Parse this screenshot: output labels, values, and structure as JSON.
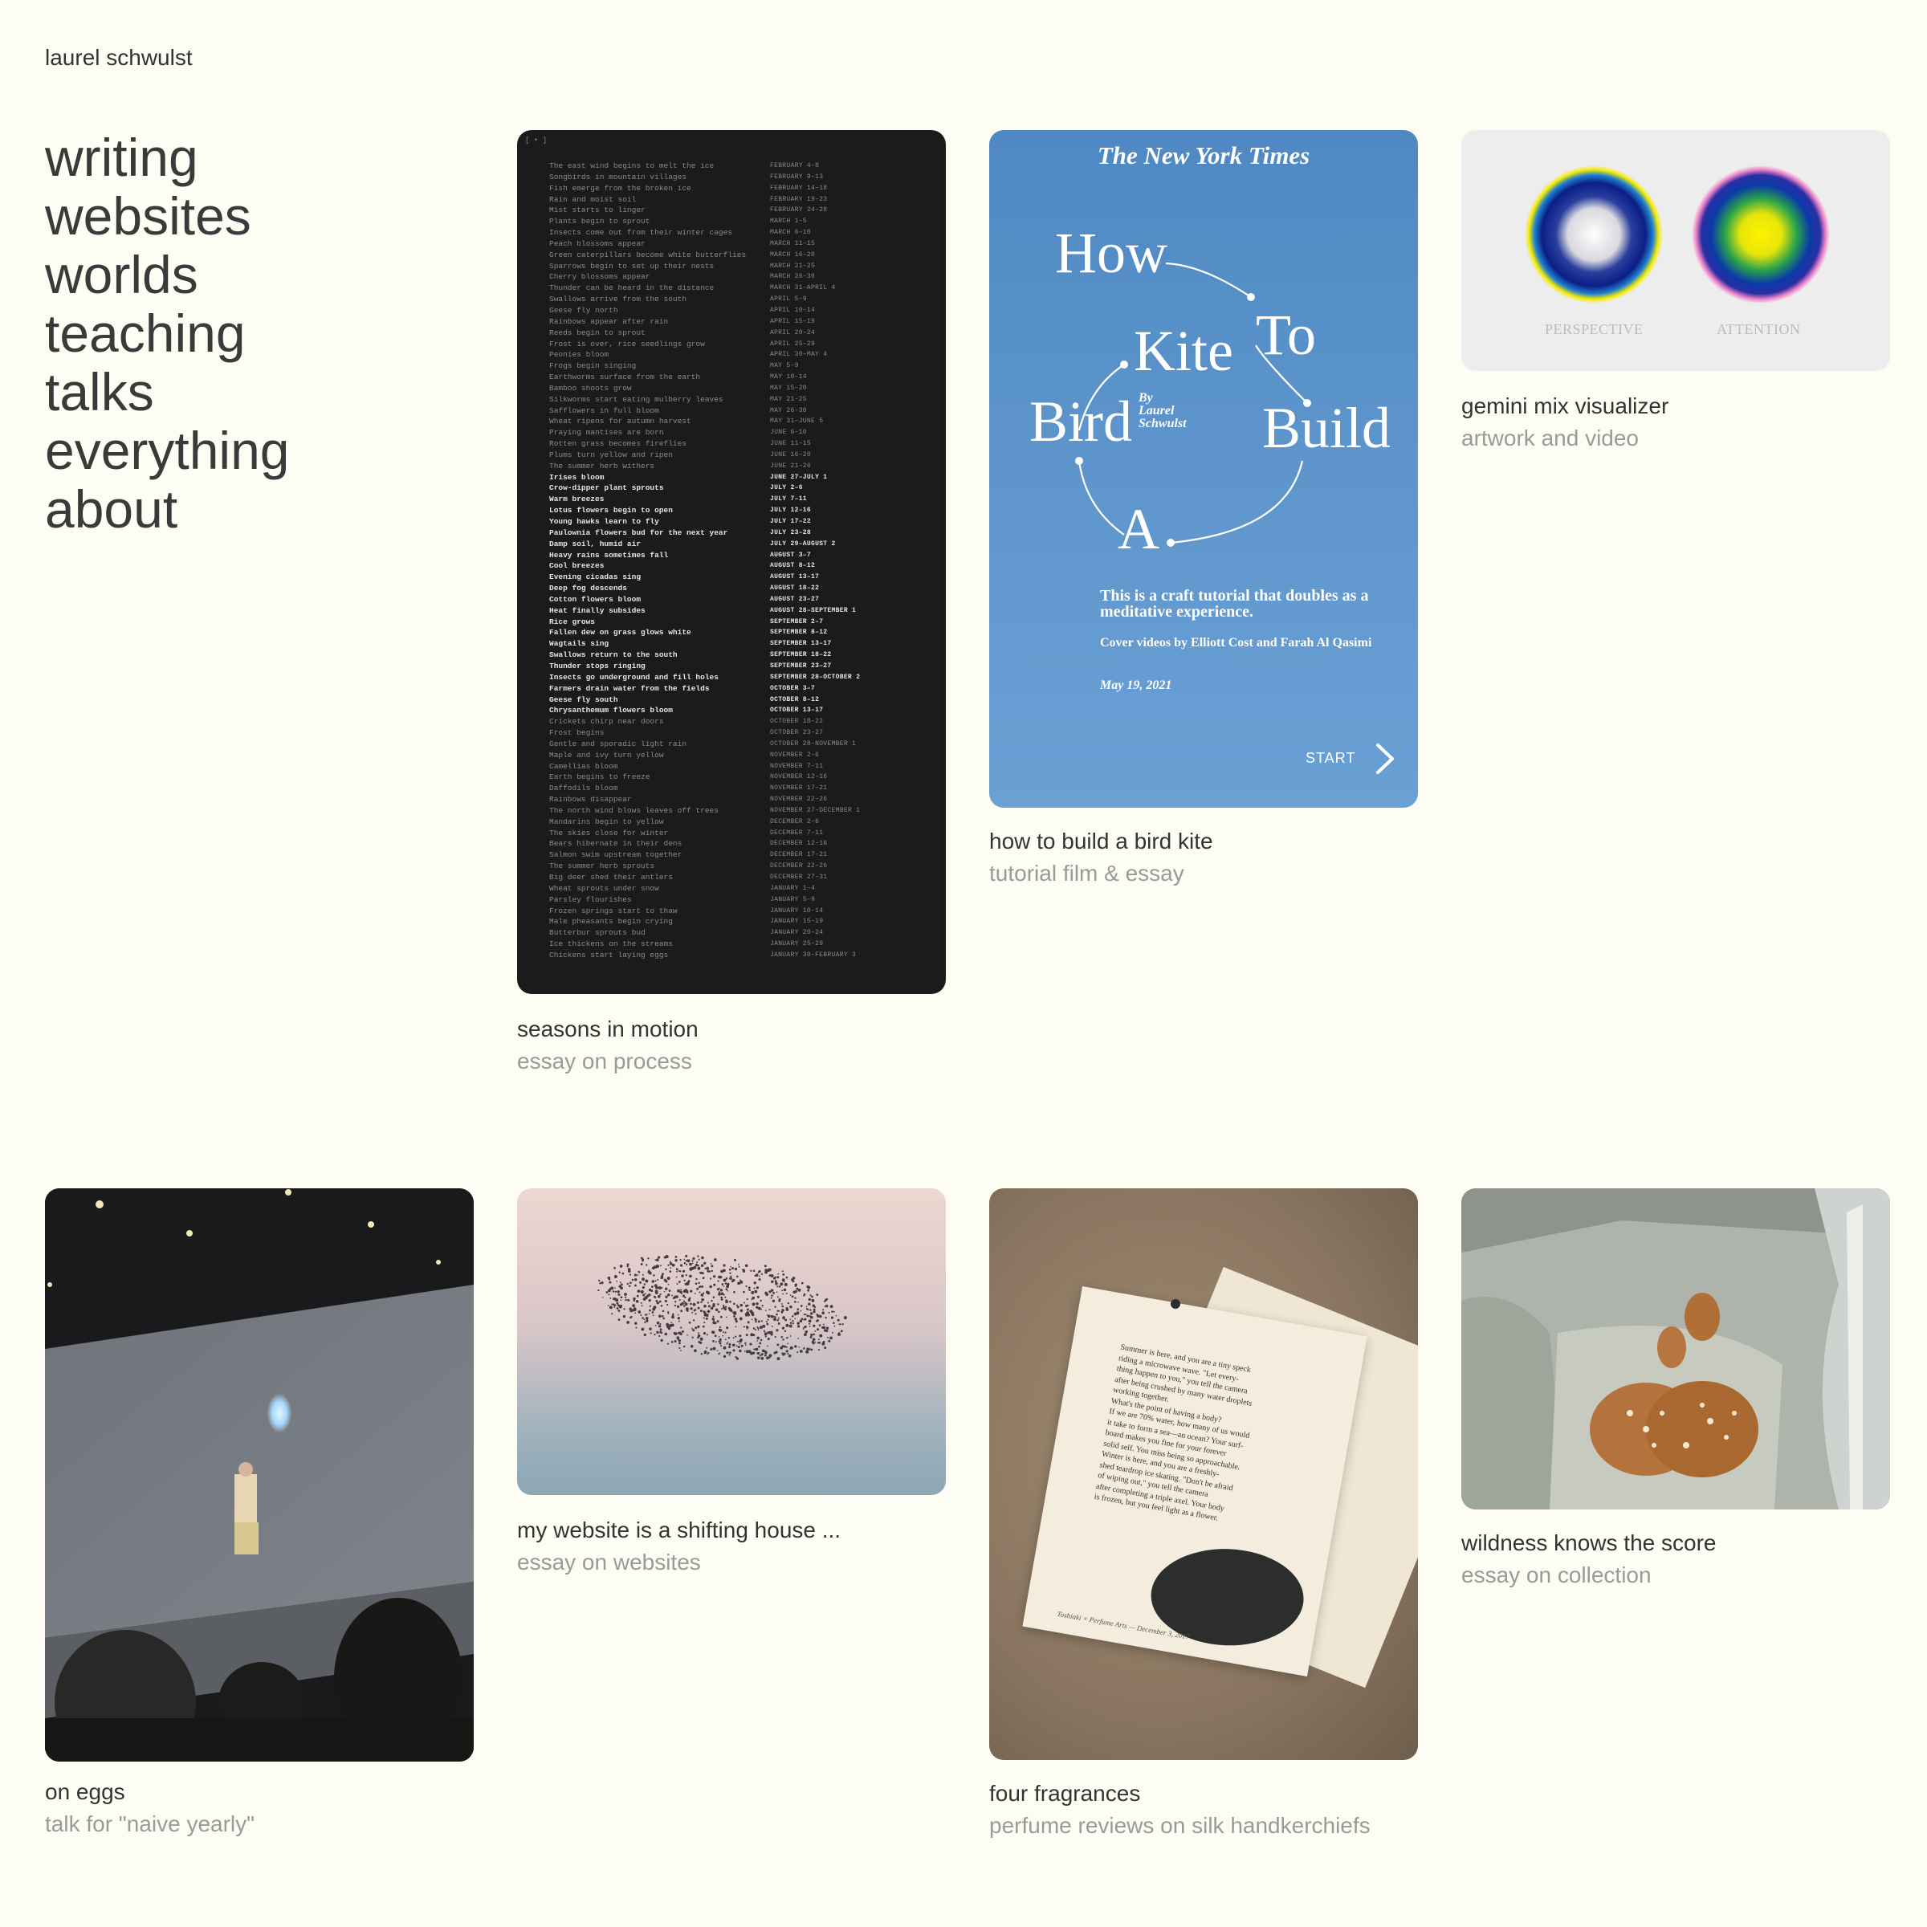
{
  "site": {
    "name": "laurel schwulst"
  },
  "nav": [
    {
      "label": "writing"
    },
    {
      "label": "websites"
    },
    {
      "label": "worlds"
    },
    {
      "label": "teaching"
    },
    {
      "label": "talks"
    },
    {
      "label": "everything"
    },
    {
      "label": "about"
    }
  ],
  "cards": {
    "seasons": {
      "title": "seasons in motion",
      "subtitle": "essay on process",
      "thumb": {
        "corner_label": "[ • ]",
        "rows": [
          [
            "The east wind begins to melt the ice",
            "FEBRUARY 4–8"
          ],
          [
            "Songbirds in mountain villages",
            "FEBRUARY 9–13"
          ],
          [
            "Fish emerge from the broken ice",
            "FEBRUARY 14–18"
          ],
          [
            "Rain and moist soil",
            "FEBRUARY 19–23"
          ],
          [
            "Mist starts to linger",
            "FEBRUARY 24–28"
          ],
          [
            "Plants begin to sprout",
            "MARCH 1–5"
          ],
          [
            "Insects come out from their winter cages",
            "MARCH 6–10"
          ],
          [
            "Peach blossoms appear",
            "MARCH 11–15"
          ],
          [
            "Green caterpillars become white butterflies",
            "MARCH 16–20"
          ],
          [
            "Sparrows begin to set up their nests",
            "MARCH 21–25"
          ],
          [
            "Cherry blossoms appear",
            "MARCH 26–30"
          ],
          [
            "Thunder can be heard in the distance",
            "MARCH 31–APRIL 4"
          ],
          [
            "Swallows arrive from the south",
            "APRIL 5–9"
          ],
          [
            "Geese fly north",
            "APRIL 10–14"
          ],
          [
            "Rainbows appear after rain",
            "APRIL 15–19"
          ],
          [
            "Reeds begin to sprout",
            "APRIL 20–24"
          ],
          [
            "Frost is over, rice seedlings grow",
            "APRIL 25–29"
          ],
          [
            "Peonies bloom",
            "APRIL 30–MAY 4"
          ],
          [
            "Frogs begin singing",
            "MAY 5–9"
          ],
          [
            "Earthworms surface from the earth",
            "MAY 10–14"
          ],
          [
            "Bamboo shoots grow",
            "MAY 15–20"
          ],
          [
            "Silkworms start eating mulberry leaves",
            "MAY 21–25"
          ],
          [
            "Safflowers in full bloom",
            "MAY 26–30"
          ],
          [
            "Wheat ripens for autumn harvest",
            "MAY 31–JUNE 5"
          ],
          [
            "Praying mantises are born",
            "JUNE 6–10"
          ],
          [
            "Rotten grass becomes fireflies",
            "JUNE 11–15"
          ],
          [
            "Plums turn yellow and ripen",
            "JUNE 16–20"
          ],
          [
            "The summer herb withers",
            "JUNE 21–26"
          ],
          [
            "Irises bloom",
            "JUNE 27–JULY 1"
          ],
          [
            "Crow-dipper plant sprouts",
            "JULY 2–6"
          ],
          [
            "Warm breezes",
            "JULY 7–11"
          ],
          [
            "Lotus flowers begin to open",
            "JULY 12–16"
          ],
          [
            "Young hawks learn to fly",
            "JULY 17–22"
          ],
          [
            "Paulownia flowers bud for the next year",
            "JULY 23–28"
          ],
          [
            "Damp soil, humid air",
            "JULY 29–AUGUST 2"
          ],
          [
            "Heavy rains sometimes fall",
            "AUGUST 3–7"
          ],
          [
            "Cool breezes",
            "AUGUST 8–12"
          ],
          [
            "Evening cicadas sing",
            "AUGUST 13–17"
          ],
          [
            "Deep fog descends",
            "AUGUST 18–22"
          ],
          [
            "Cotton flowers bloom",
            "AUGUST 23–27"
          ],
          [
            "Heat finally subsides",
            "AUGUST 28–SEPTEMBER 1"
          ],
          [
            "Rice grows",
            "SEPTEMBER 2–7"
          ],
          [
            "Fallen dew on grass glows white",
            "SEPTEMBER 8–12"
          ],
          [
            "Wagtails sing",
            "SEPTEMBER 13–17"
          ],
          [
            "Swallows return to the south",
            "SEPTEMBER 18–22"
          ],
          [
            "Thunder stops ringing",
            "SEPTEMBER 23–27"
          ],
          [
            "Insects go underground and fill holes",
            "SEPTEMBER 28–OCTOBER 2"
          ],
          [
            "Farmers drain water from the fields",
            "OCTOBER 3–7"
          ],
          [
            "Geese fly south",
            "OCTOBER 8–12"
          ],
          [
            "Chrysanthemum flowers bloom",
            "OCTOBER 13–17"
          ],
          [
            "Crickets chirp near doors",
            "OCTOBER 18–22"
          ],
          [
            "Frost begins",
            "OCTOBER 23–27"
          ],
          [
            "Gentle and sporadic light rain",
            "OCTOBER 28–NOVEMBER 1"
          ],
          [
            "Maple and ivy turn yellow",
            "NOVEMBER 2–6"
          ],
          [
            "Camellias bloom",
            "NOVEMBER 7–11"
          ],
          [
            "Earth begins to freeze",
            "NOVEMBER 12–16"
          ],
          [
            "Daffodils bloom",
            "NOVEMBER 17–21"
          ],
          [
            "Rainbows disappear",
            "NOVEMBER 22–26"
          ],
          [
            "The north wind blows leaves off trees",
            "NOVEMBER 27–DECEMBER 1"
          ],
          [
            "Mandarins begin to yellow",
            "DECEMBER 2–6"
          ],
          [
            "The skies close for winter",
            "DECEMBER 7–11"
          ],
          [
            "Bears hibernate in their dens",
            "DECEMBER 12–16"
          ],
          [
            "Salmon swim upstream together",
            "DECEMBER 17–21"
          ],
          [
            "The summer herb sprouts",
            "DECEMBER 22–26"
          ],
          [
            "Big deer shed their antlers",
            "DECEMBER 27–31"
          ],
          [
            "Wheat sprouts under snow",
            "JANUARY 1–4"
          ],
          [
            "Parsley flourishes",
            "JANUARY 5–9"
          ],
          [
            "Frozen springs start to thaw",
            "JANUARY 10–14"
          ],
          [
            "Male pheasants begin crying",
            "JANUARY 15–19"
          ],
          [
            "Butterbur sprouts bud",
            "JANUARY 20–24"
          ],
          [
            "Ice thickens on the streams",
            "JANUARY 25–29"
          ],
          [
            "Chickens start laying eggs",
            "JANUARY 30–FEBRUARY 3"
          ]
        ],
        "bright_from": 28,
        "bright_to": 49
      }
    },
    "birdkite": {
      "title": "how to build a bird kite",
      "subtitle": "tutorial film & essay",
      "thumb": {
        "masthead": "The New York Times",
        "words": [
          "How",
          "To",
          "Kite",
          "Bird",
          "Build",
          "A"
        ],
        "byline": [
          "By",
          "Laurel",
          "Schwulst"
        ],
        "description": "This is a craft tutorial that doubles as a meditative experience.",
        "credits": "Cover videos by Elliott Cost and Farah Al Qasimi",
        "date": "May 19, 2021",
        "start_label": "START"
      }
    },
    "gemini": {
      "title": "gemini mix visualizer",
      "subtitle": "artwork and video",
      "thumb": {
        "labels": [
          "PERSPECTIVE",
          "ATTENTION"
        ]
      }
    },
    "eggs": {
      "title": "on eggs",
      "subtitle": "talk for \"naive yearly\""
    },
    "website": {
      "title": "my website is a shifting house ...",
      "subtitle": "essay on websites"
    },
    "fragrances": {
      "title": "four fragrances",
      "subtitle": "perfume reviews on silk handkerchiefs",
      "thumb": {
        "lines": [
          "Summer is here, and you are a tiny speck",
          "riding a microwave wave. \"Let every-",
          "thing happen to you,\" you tell the camera",
          "after being crushed by many water droplets",
          "working together.",
          "What's the point of having a body?",
          "If we are 70% water, how many of us would",
          "it take to form a sea—an ocean? Your surf-",
          "board makes you fine for your forever",
          "solid self. You miss being so approachable.",
          "Winter is here, and you are a freshly-",
          "shed teardrop ice skating. \"Don't be afraid",
          "of wiping out,\" you tell the camera",
          "after completing a triple axel. Your body",
          "is frozen, but you feel light as a flower."
        ],
        "footer": "Toshiaki × Perfume Arts — December 3, 2017"
      }
    },
    "wildness": {
      "title": "wildness knows the score",
      "subtitle": "essay on collection"
    }
  },
  "colors": {
    "background": "#fdfdf3",
    "text": "#333333",
    "muted": "#9a9a9a",
    "nyt_blue": "#5b93cb"
  }
}
